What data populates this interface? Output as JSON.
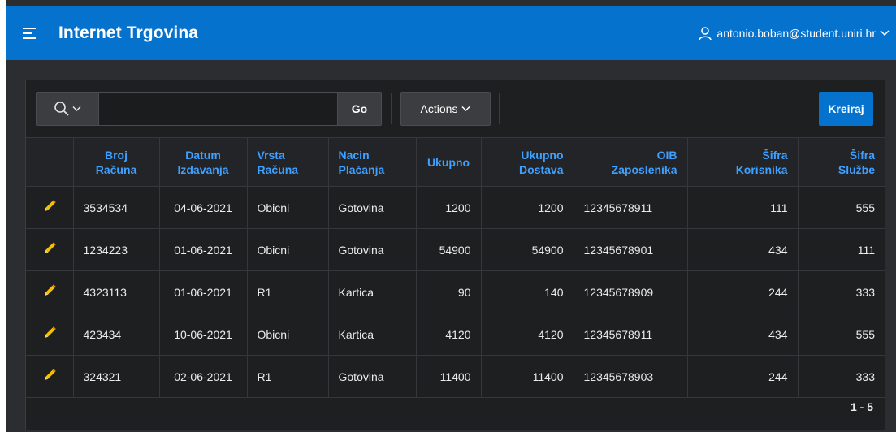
{
  "header": {
    "app_title": "Internet Trgovina",
    "user": "antonio.boban@student.uniri.hr"
  },
  "toolbar": {
    "search_value": "",
    "go_label": "Go",
    "actions_label": "Actions",
    "create_label": "Kreiraj"
  },
  "table": {
    "columns": [
      {
        "line1": "Broj",
        "line2": "Računa"
      },
      {
        "line1": "Datum",
        "line2": "Izdavanja"
      },
      {
        "line1": "Vrsta",
        "line2": "Računa"
      },
      {
        "line1": "Nacin",
        "line2": "Plaćanja"
      },
      {
        "line1": "Ukupno",
        "line2": ""
      },
      {
        "line1": "Ukupno",
        "line2": "Dostava"
      },
      {
        "line1": "OIB",
        "line2": "Zaposlenika"
      },
      {
        "line1": "Šifra",
        "line2": "Korisnika"
      },
      {
        "line1": "Šifra",
        "line2": "Službe"
      }
    ],
    "rows": [
      [
        "3534534",
        "04-06-2021",
        "Obicni",
        "Gotovina",
        "1200",
        "1200",
        "12345678911",
        "111",
        "555"
      ],
      [
        "1234223",
        "01-06-2021",
        "Obicni",
        "Gotovina",
        "54900",
        "54900",
        "12345678901",
        "434",
        "111"
      ],
      [
        "4323113",
        "01-06-2021",
        "R1",
        "Kartica",
        "90",
        "140",
        "12345678909",
        "244",
        "333"
      ],
      [
        "423434",
        "10-06-2021",
        "Obicni",
        "Kartica",
        "4120",
        "4120",
        "12345678911",
        "434",
        "555"
      ],
      [
        "324321",
        "02-06-2021",
        "R1",
        "Gotovina",
        "11400",
        "11400",
        "12345678903",
        "244",
        "333"
      ]
    ]
  },
  "pagination": "1 - 5",
  "colors": {
    "header_bg": "#0572ce",
    "link_blue": "#3ea0ff",
    "pencil_yellow": "#f5c000"
  },
  "icons": {
    "menu": "hamburger-icon",
    "user": "user-icon",
    "search": "search-icon",
    "edit": "pencil-icon",
    "dropdown": "chevron-down-icon"
  }
}
